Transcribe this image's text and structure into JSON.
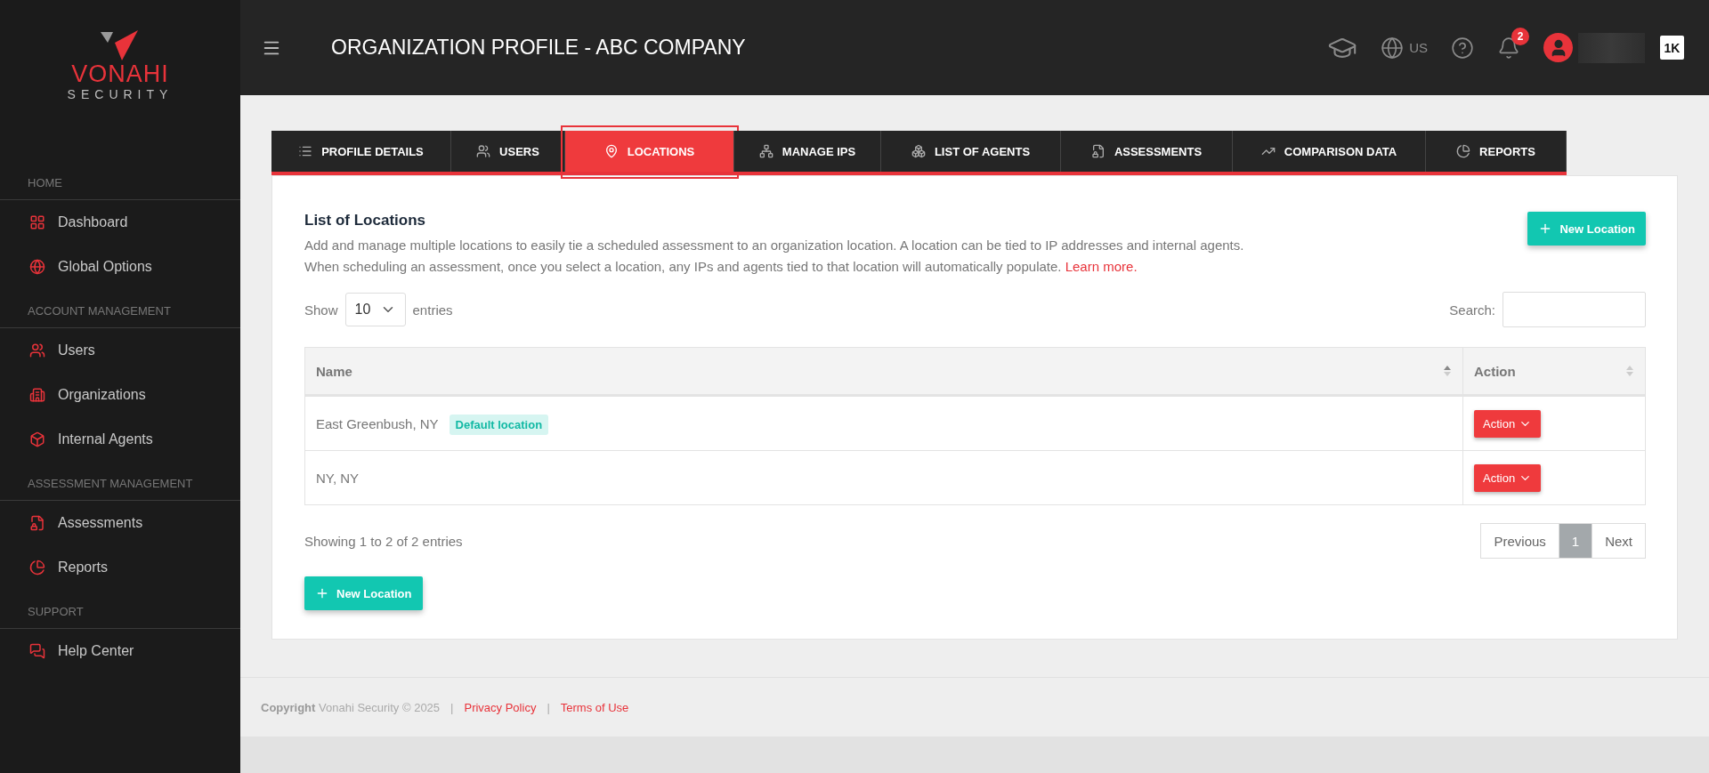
{
  "sidebar": {
    "logo": {
      "brand": "VONAHI",
      "tagline": "SECURITY"
    },
    "sections": [
      {
        "heading": "HOME",
        "items": [
          {
            "kind": "grid",
            "label": "Dashboard"
          },
          {
            "kind": "globe",
            "label": "Global Options"
          }
        ]
      },
      {
        "heading": "ACCOUNT MANAGEMENT",
        "items": [
          {
            "kind": "users",
            "label": "Users"
          },
          {
            "kind": "building",
            "label": "Organizations"
          },
          {
            "kind": "box",
            "label": "Internal Agents"
          }
        ]
      },
      {
        "heading": "ASSESSMENT MANAGEMENT",
        "items": [
          {
            "kind": "file",
            "label": "Assessments"
          },
          {
            "kind": "pie",
            "label": "Reports"
          }
        ]
      },
      {
        "heading": "SUPPORT",
        "items": [
          {
            "kind": "chat",
            "label": "Help Center"
          }
        ]
      }
    ]
  },
  "header": {
    "title": "ORGANIZATION PROFILE - ABC COMPANY",
    "language": "US",
    "notifications": "2",
    "app_badge": "1K"
  },
  "tabs": [
    {
      "kind": "list",
      "label": "PROFILE DETAILS",
      "selected": false
    },
    {
      "kind": "users",
      "label": "USERS",
      "selected": false
    },
    {
      "kind": "pin",
      "label": "LOCATIONS",
      "selected": true,
      "highlighted": true
    },
    {
      "kind": "network",
      "label": "MANAGE IPS",
      "selected": false
    },
    {
      "kind": "boxes",
      "label": "LIST OF AGENTS",
      "selected": false
    },
    {
      "kind": "file",
      "label": "ASSESSMENTS",
      "selected": false
    },
    {
      "kind": "chart",
      "label": "COMPARISON DATA",
      "selected": false
    },
    {
      "kind": "pie",
      "label": "REPORTS",
      "selected": false
    }
  ],
  "panel": {
    "title": "List of Locations",
    "description": [
      "Add and manage multiple locations to easily tie a scheduled assessment to an organization location. A location can be tied to IP addresses and internal agents.",
      "When scheduling an assessment, once you select a location, any IPs and agents tied to that location will automatically populate."
    ],
    "learn_more": "Learn more.",
    "new_button": "New Location",
    "length": {
      "before": "Show",
      "value": "10",
      "after": "entries"
    },
    "search_label": "Search:",
    "table": {
      "columns": [
        "Name",
        "Action"
      ],
      "rows": [
        {
          "name": "East Greenbush, NY",
          "tag": "Default location",
          "action": "Action"
        },
        {
          "name": "NY, NY",
          "action": "Action"
        }
      ]
    },
    "info": "Showing 1 to 2 of 2 entries",
    "pagination": [
      {
        "label": "Previous",
        "selected": false
      },
      {
        "label": "1",
        "selected": true
      },
      {
        "label": "Next",
        "selected": false
      }
    ],
    "bottom_button": "New Location"
  },
  "footer": {
    "copyright_bold": "Copyright",
    "copyright": "Vonahi Security © 2025",
    "separator": "|",
    "links": [
      "Privacy Policy",
      "Terms of Use"
    ]
  }
}
